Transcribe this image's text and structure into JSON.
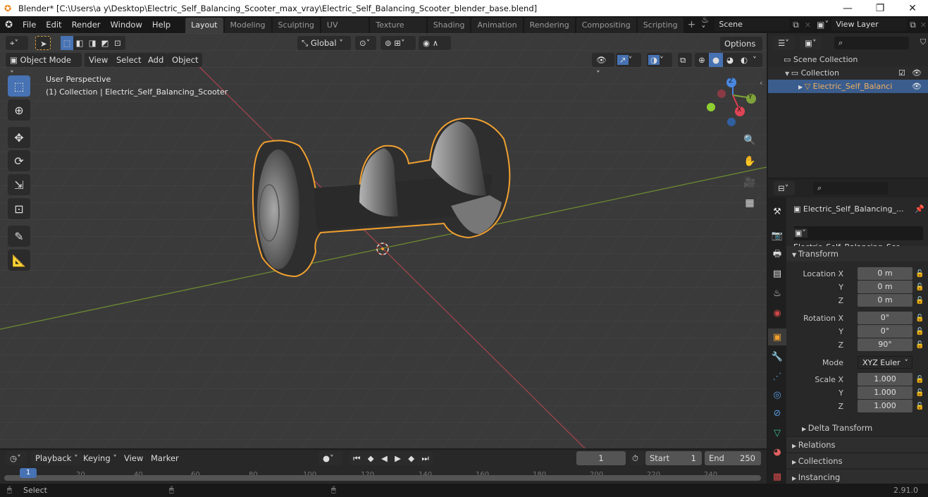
{
  "window": {
    "title": "Blender* [C:\\Users\\a y\\Desktop\\Electric_Self_Balancing_Scooter_max_vray\\Electric_Self_Balancing_Scooter_blender_base.blend]",
    "minimize": "—",
    "maximize": "❐",
    "close": "✕"
  },
  "menu": [
    "File",
    "Edit",
    "Render",
    "Window",
    "Help"
  ],
  "workspaces": [
    "Layout",
    "Modeling",
    "Sculpting",
    "UV Editing",
    "Texture Paint",
    "Shading",
    "Animation",
    "Rendering",
    "Compositing",
    "Scripting"
  ],
  "active_workspace": "Layout",
  "scene": {
    "name": "Scene",
    "view_layer": "View Layer"
  },
  "viewport": {
    "mode": "Object Mode",
    "menus": [
      "View",
      "Select",
      "Add",
      "Object"
    ],
    "orientation": "Global",
    "options": "Options",
    "info_line1": "User Perspective",
    "info_line2": "(1) Collection | Electric_Self_Balancing_Scooter",
    "gizmo": {
      "x": "X",
      "y": "Y",
      "z": "Z"
    },
    "colors": {
      "selection_outline": "#f0a030",
      "x_axis": "#c24a55",
      "y_axis": "#7fa23a",
      "active_tool": "#4772b3"
    }
  },
  "outliner": {
    "items": [
      {
        "label": "Scene Collection",
        "level": 0
      },
      {
        "label": "Collection",
        "level": 1
      },
      {
        "label": "Electric_Self_Balanci",
        "level": 2,
        "selected": true
      }
    ]
  },
  "properties": {
    "object_name": "Electric_Self_Balancing_...",
    "data_name": "Electric_Self_Balancing_Sco...",
    "transform_header": "Transform",
    "location": {
      "label": "Location X",
      "x": "0 m",
      "y": "0 m",
      "z": "0 m"
    },
    "rotation": {
      "label": "Rotation X",
      "x": "0°",
      "y": "0°",
      "z": "90°"
    },
    "mode_label": "Mode",
    "mode_value": "XYZ Euler",
    "scale": {
      "label": "Scale X",
      "x": "1.000",
      "y": "1.000",
      "z": "1.000"
    },
    "axis_y": "Y",
    "axis_z": "Z",
    "subpanels": [
      "Delta Transform"
    ],
    "panels": [
      "Relations",
      "Collections",
      "Instancing"
    ]
  },
  "timeline": {
    "menus": [
      "Playback",
      "Keying",
      "View",
      "Marker"
    ],
    "current_frame": "1",
    "start_label": "Start",
    "start": "1",
    "end_label": "End",
    "end": "250",
    "ticks": [
      "20",
      "40",
      "60",
      "80",
      "100",
      "120",
      "140",
      "160",
      "180",
      "200",
      "220",
      "240"
    ],
    "playhead": "1"
  },
  "status": {
    "select": "Select",
    "version": "2.91.0"
  }
}
